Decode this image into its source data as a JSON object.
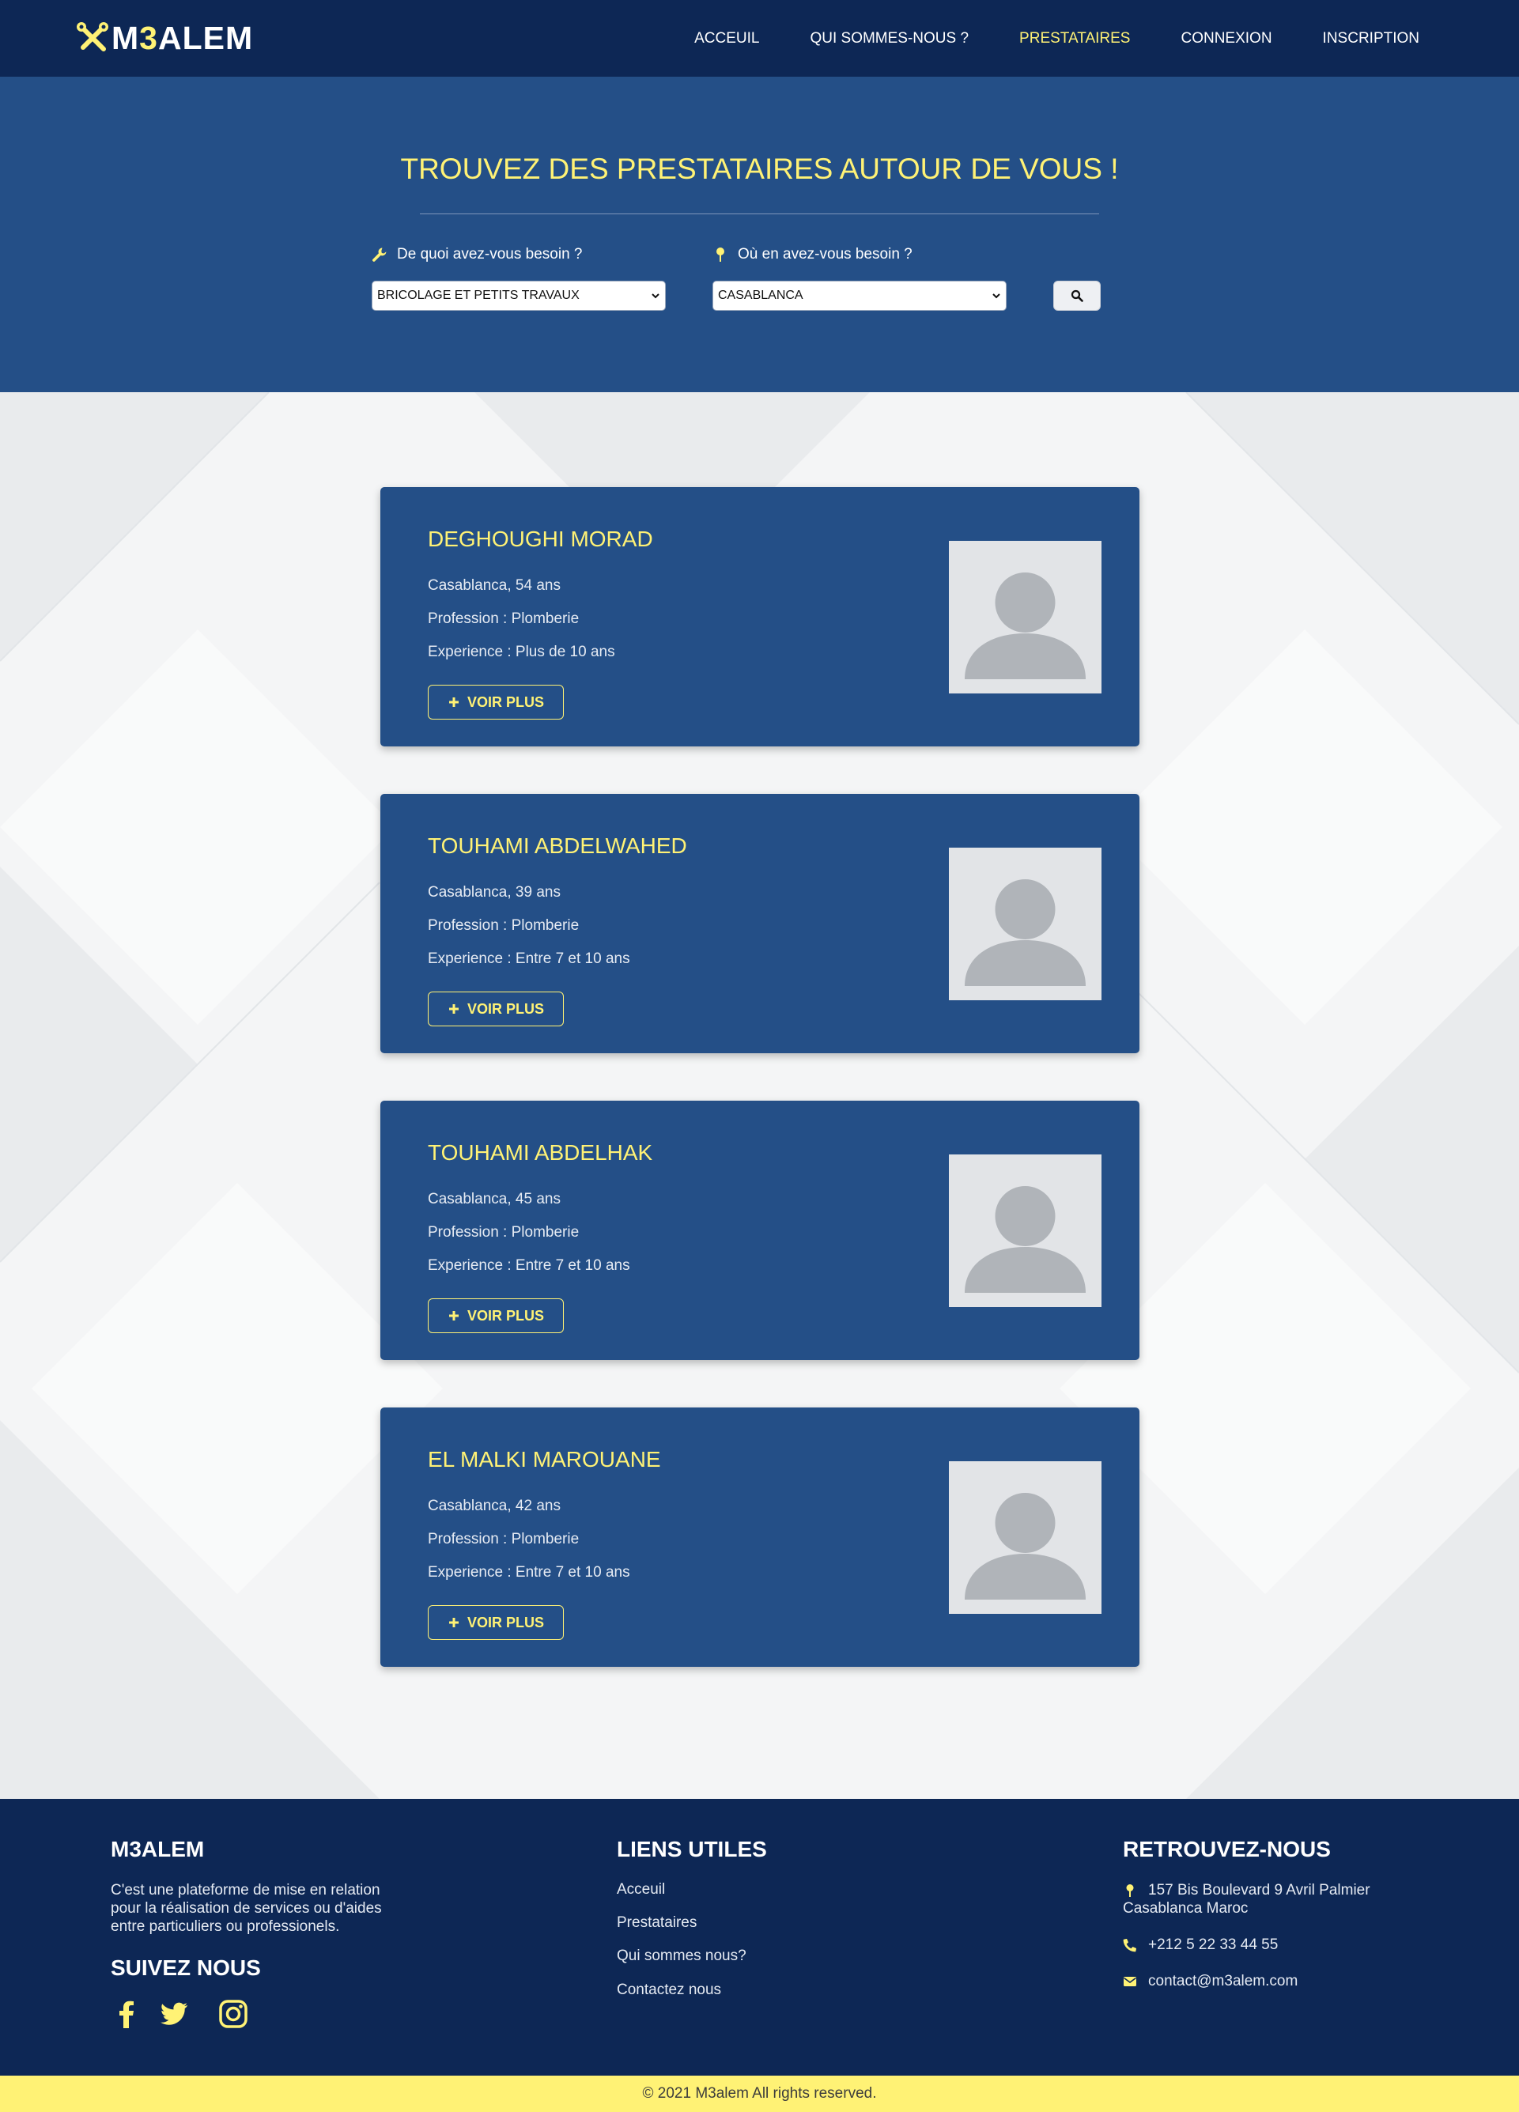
{
  "brand": {
    "name_prefix": "M",
    "name_accent": "3",
    "name_suffix": "ALEM"
  },
  "nav": {
    "items": [
      {
        "label": "ACCEUIL"
      },
      {
        "label": "QUI SOMMES-NOUS ?"
      },
      {
        "label": "PRESTATAIRES"
      },
      {
        "label": "CONNEXION"
      },
      {
        "label": "INSCRIPTION"
      }
    ],
    "active": "PRESTATAIRES"
  },
  "hero": {
    "title": "TROUVEZ DES PRESTATAIRES AUTOUR DE VOUS !",
    "need_label": "De quoi avez-vous besoin ?",
    "need_value": "BRICOLAGE ET PETITS TRAVAUX",
    "where_label": "Où en avez-vous besoin ?",
    "where_value": "CASABLANCA"
  },
  "providers": [
    {
      "name": "DEGHOUGHI MORAD",
      "location": "Casablanca, 54 ans",
      "profession": "Profession : Plomberie",
      "experience": "Experience : Plus de 10 ans",
      "button": "VOIR PLUS"
    },
    {
      "name": "TOUHAMI ABDELWAHED",
      "location": "Casablanca, 39 ans",
      "profession": "Profession : Plomberie",
      "experience": "Experience : Entre 7 et 10 ans",
      "button": "VOIR PLUS"
    },
    {
      "name": "TOUHAMI ABDELHAK",
      "location": "Casablanca, 45 ans",
      "profession": "Profession : Plomberie",
      "experience": "Experience : Entre 7 et 10 ans",
      "button": "VOIR PLUS"
    },
    {
      "name": "EL MALKI MAROUANE",
      "location": "Casablanca, 42 ans",
      "profession": "Profession : Plomberie",
      "experience": "Experience : Entre 7 et 10 ans",
      "button": "VOIR PLUS"
    }
  ],
  "footer": {
    "about_title": "M3ALEM",
    "about_text_1": "C'est une plateforme de mise en relation",
    "about_text_2": "pour la réalisation de services ou d'aides",
    "about_text_3": "entre particuliers ou professionels.",
    "follow_title": "SUIVEZ NOUS",
    "social": [
      "facebook-icon",
      "twitter-icon",
      "instagram-icon"
    ],
    "links_title": "LIENS UTILES",
    "links": [
      "Acceuil",
      "Prestataires",
      "Qui sommes nous?",
      "Contactez nous"
    ],
    "contact_title": "RETROUVEZ-NOUS",
    "address_1": "157 Bis Boulevard 9 Avril Palmier",
    "address_2": "Casablanca Maroc",
    "phone": "+212 5 22 33 44 55",
    "email": "contact@m3alem.com"
  },
  "copyright": "© 2021 M3alem All rights reserved.",
  "colors": {
    "navy": "#0d2755",
    "blue": "#244f87",
    "accent": "#fff275"
  }
}
